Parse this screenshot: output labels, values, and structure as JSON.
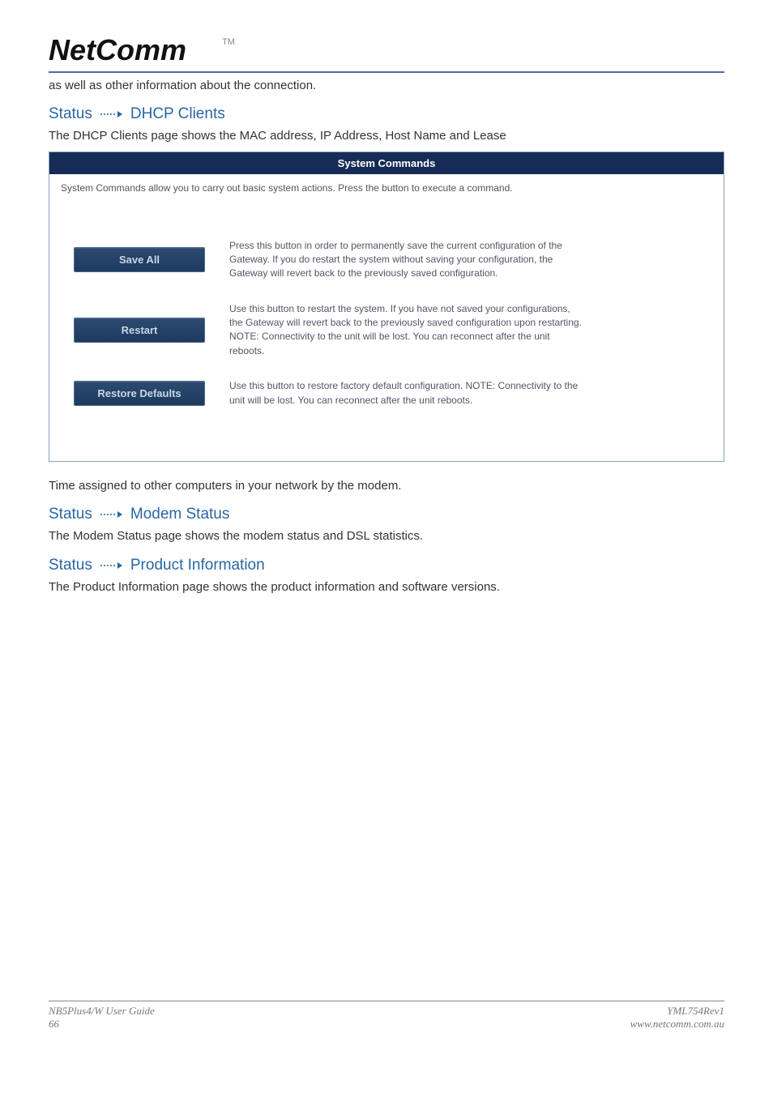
{
  "logo_text": "NetComm",
  "tm": "TM",
  "intro_continuation": "as well as other information about the connection.",
  "sections": {
    "dhcp": {
      "prefix": "Status",
      "suffix": "DHCP Clients",
      "paragraph": "The DHCP Clients page shows the MAC address, IP Address, Host Name and Lease"
    },
    "modem": {
      "prefix": "Status",
      "suffix": "Modem Status",
      "paragraph": "The Modem Status page shows the modem status and DSL statistics."
    },
    "product": {
      "prefix": "Status",
      "suffix": "Product Information",
      "paragraph": "The Product Information page shows the product information and software versions."
    }
  },
  "panel": {
    "title": "System Commands",
    "subtitle": "System Commands allow you to carry out basic system actions. Press the button to execute a command.",
    "rows": {
      "save": {
        "button": "Save All",
        "desc": "Press this button in order to permanently save the current configuration of the Gateway. If you do restart the system without saving your configuration, the Gateway will revert back to the previously saved configuration."
      },
      "restart": {
        "button": "Restart",
        "desc": "Use this button to restart the system. If you have not saved your configurations, the Gateway will revert back to the previously saved configuration upon restarting. NOTE: Connectivity to the unit will be lost. You can reconnect after the unit reboots."
      },
      "restore": {
        "button": "Restore Defaults",
        "desc": "Use this button to restore factory default configuration. NOTE: Connectivity to the unit will be lost. You can reconnect after the unit reboots."
      }
    }
  },
  "after_panel_text": "Time assigned to other computers in your network by the modem.",
  "footer": {
    "left1": "NB5Plus4/W User Guide",
    "left2": "66",
    "right1": "YML754Rev1",
    "right2": "www.netcomm.com.au"
  }
}
